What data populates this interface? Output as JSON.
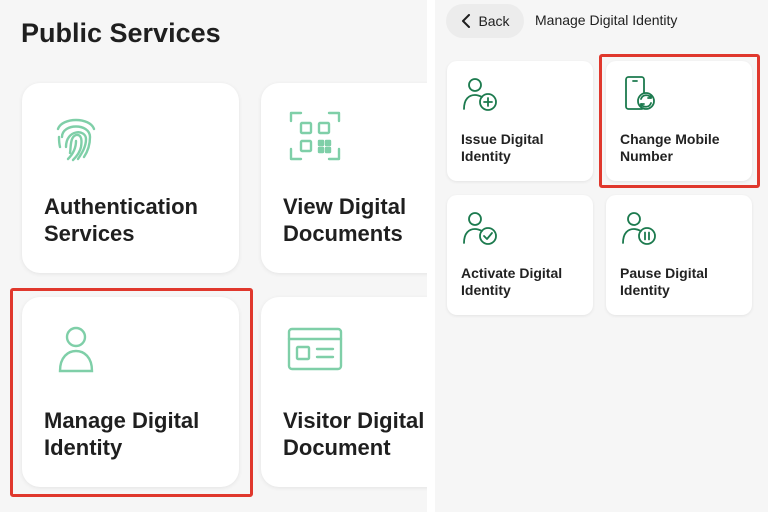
{
  "left_screen": {
    "title": "Public Services",
    "cards": [
      {
        "label": "Authentication\nServices",
        "icon": "fingerprint-icon"
      },
      {
        "label": "View Digital\nDocuments",
        "icon": "qr-code-icon"
      },
      {
        "label": "Manage Digital\nIdentity",
        "icon": "person-icon"
      },
      {
        "label": "Visitor Digital\nDocument",
        "icon": "id-card-icon"
      }
    ]
  },
  "right_screen": {
    "back_label": "Back",
    "nav_title": "Manage Digital Identity",
    "cards": [
      {
        "label": "Issue Digital\nIdentity",
        "icon": "add-person-icon"
      },
      {
        "label": "Change Mobile\nNumber",
        "icon": "phone-sync-icon"
      },
      {
        "label": "Activate Digital\nIdentity",
        "icon": "person-check-icon"
      },
      {
        "label": "Pause Digital\nIdentity",
        "icon": "person-pause-icon"
      }
    ]
  },
  "colors": {
    "icon_light_green": "#7fcfa8",
    "icon_dark_green": "#1c7a4e",
    "highlight_red": "#e0382d"
  }
}
